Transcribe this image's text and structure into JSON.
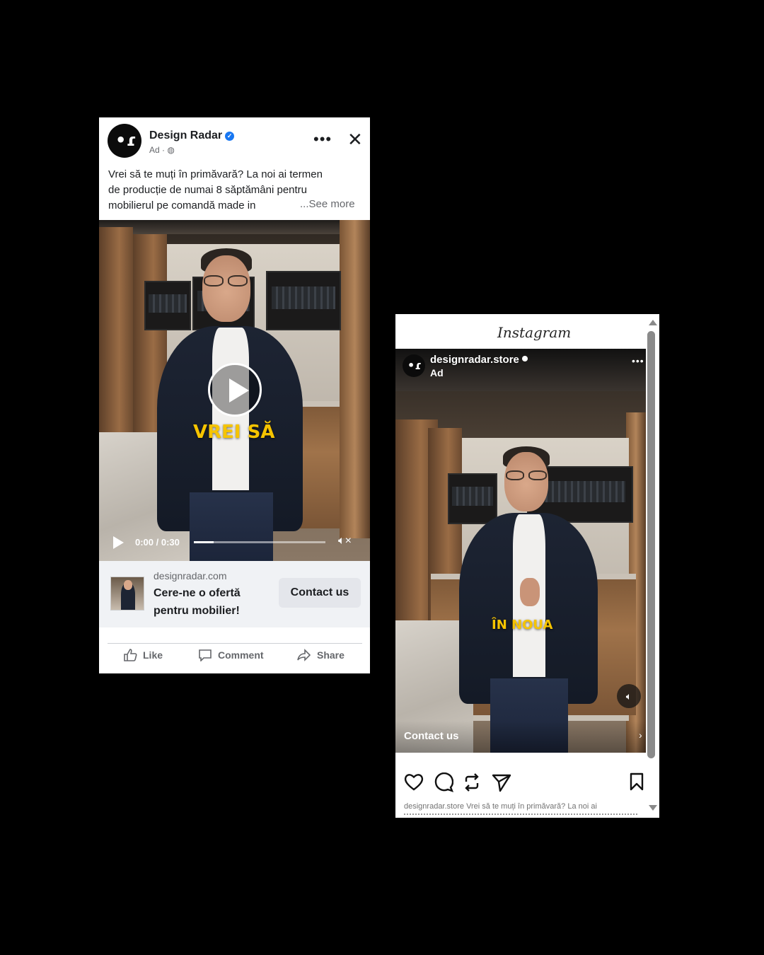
{
  "facebook_ad": {
    "page_name": "Design Radar",
    "sponsored_label": "Ad · ",
    "more_icon": "more-horizontal-icon",
    "close_icon": "close-icon",
    "post_text_lines": [
      "Vrei să te muți în primăvară? La noi ai termen",
      "de producție de numai 8 săptămâni pentru",
      "mobilierul pe comandă made in"
    ],
    "see_more": "...See more",
    "video": {
      "caption": "VREI SĂ",
      "time": "0:00 / 0:30",
      "progress_fraction": 0.15
    },
    "cta": {
      "domain": "designradar.com",
      "headline": "Cere-ne o ofertă pentru mobilier!",
      "button": "Contact us"
    },
    "actions": {
      "like": "Like",
      "comment": "Comment",
      "share": "Share"
    }
  },
  "instagram_ad": {
    "app_logo": "Instagram",
    "username": "designradar.store",
    "sponsored_label": "Ad",
    "video": {
      "caption": "ÎN NOUA"
    },
    "cta_label": "Contact us",
    "caption_username": "designradar.store",
    "caption_text": "Vrei să te muți în primăvară? La noi ai",
    "action_icons": [
      "heart-icon",
      "comment-icon",
      "repost-icon",
      "send-icon",
      "bookmark-icon"
    ]
  },
  "colors": {
    "background": "#000000",
    "fb_blue": "#1877f2",
    "caption_yellow": "#f6c400"
  }
}
